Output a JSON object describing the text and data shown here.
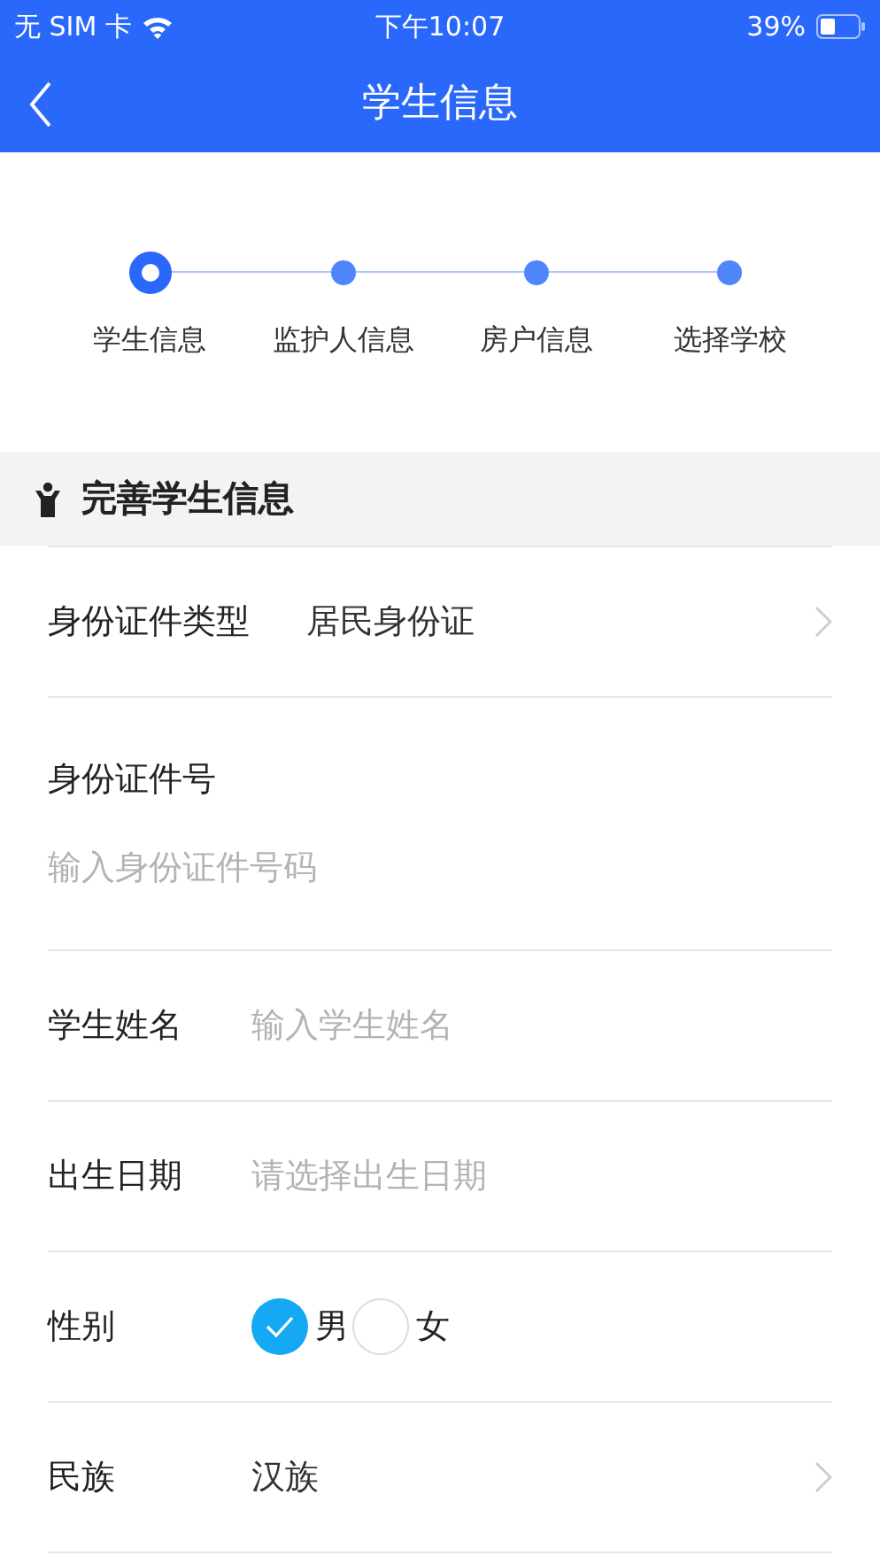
{
  "status_bar": {
    "carrier": "无 SIM 卡",
    "time": "下午10:07",
    "battery": "39%"
  },
  "nav": {
    "title": "学生信息"
  },
  "steps": [
    {
      "label": "学生信息",
      "selected": true
    },
    {
      "label": "监护人信息",
      "selected": false
    },
    {
      "label": "房户信息",
      "selected": false
    },
    {
      "label": "选择学校",
      "selected": false
    }
  ],
  "section": {
    "title": "完善学生信息"
  },
  "rows": [
    {
      "kind": "select",
      "label": "身份证件类型",
      "value": "居民身份证"
    },
    {
      "kind": "stacked_input",
      "label": "身份证件号",
      "placeholder": "输入身份证件号码"
    },
    {
      "kind": "input",
      "label": "学生姓名",
      "placeholder": "输入学生姓名"
    },
    {
      "kind": "input",
      "label": "出生日期",
      "placeholder": "请选择出生日期"
    },
    {
      "kind": "radio",
      "label": "性别",
      "options": [
        {
          "label": "男",
          "selected": true
        },
        {
          "label": "女",
          "selected": false
        }
      ]
    },
    {
      "kind": "select",
      "label": "民族",
      "value": "汉族"
    }
  ]
}
